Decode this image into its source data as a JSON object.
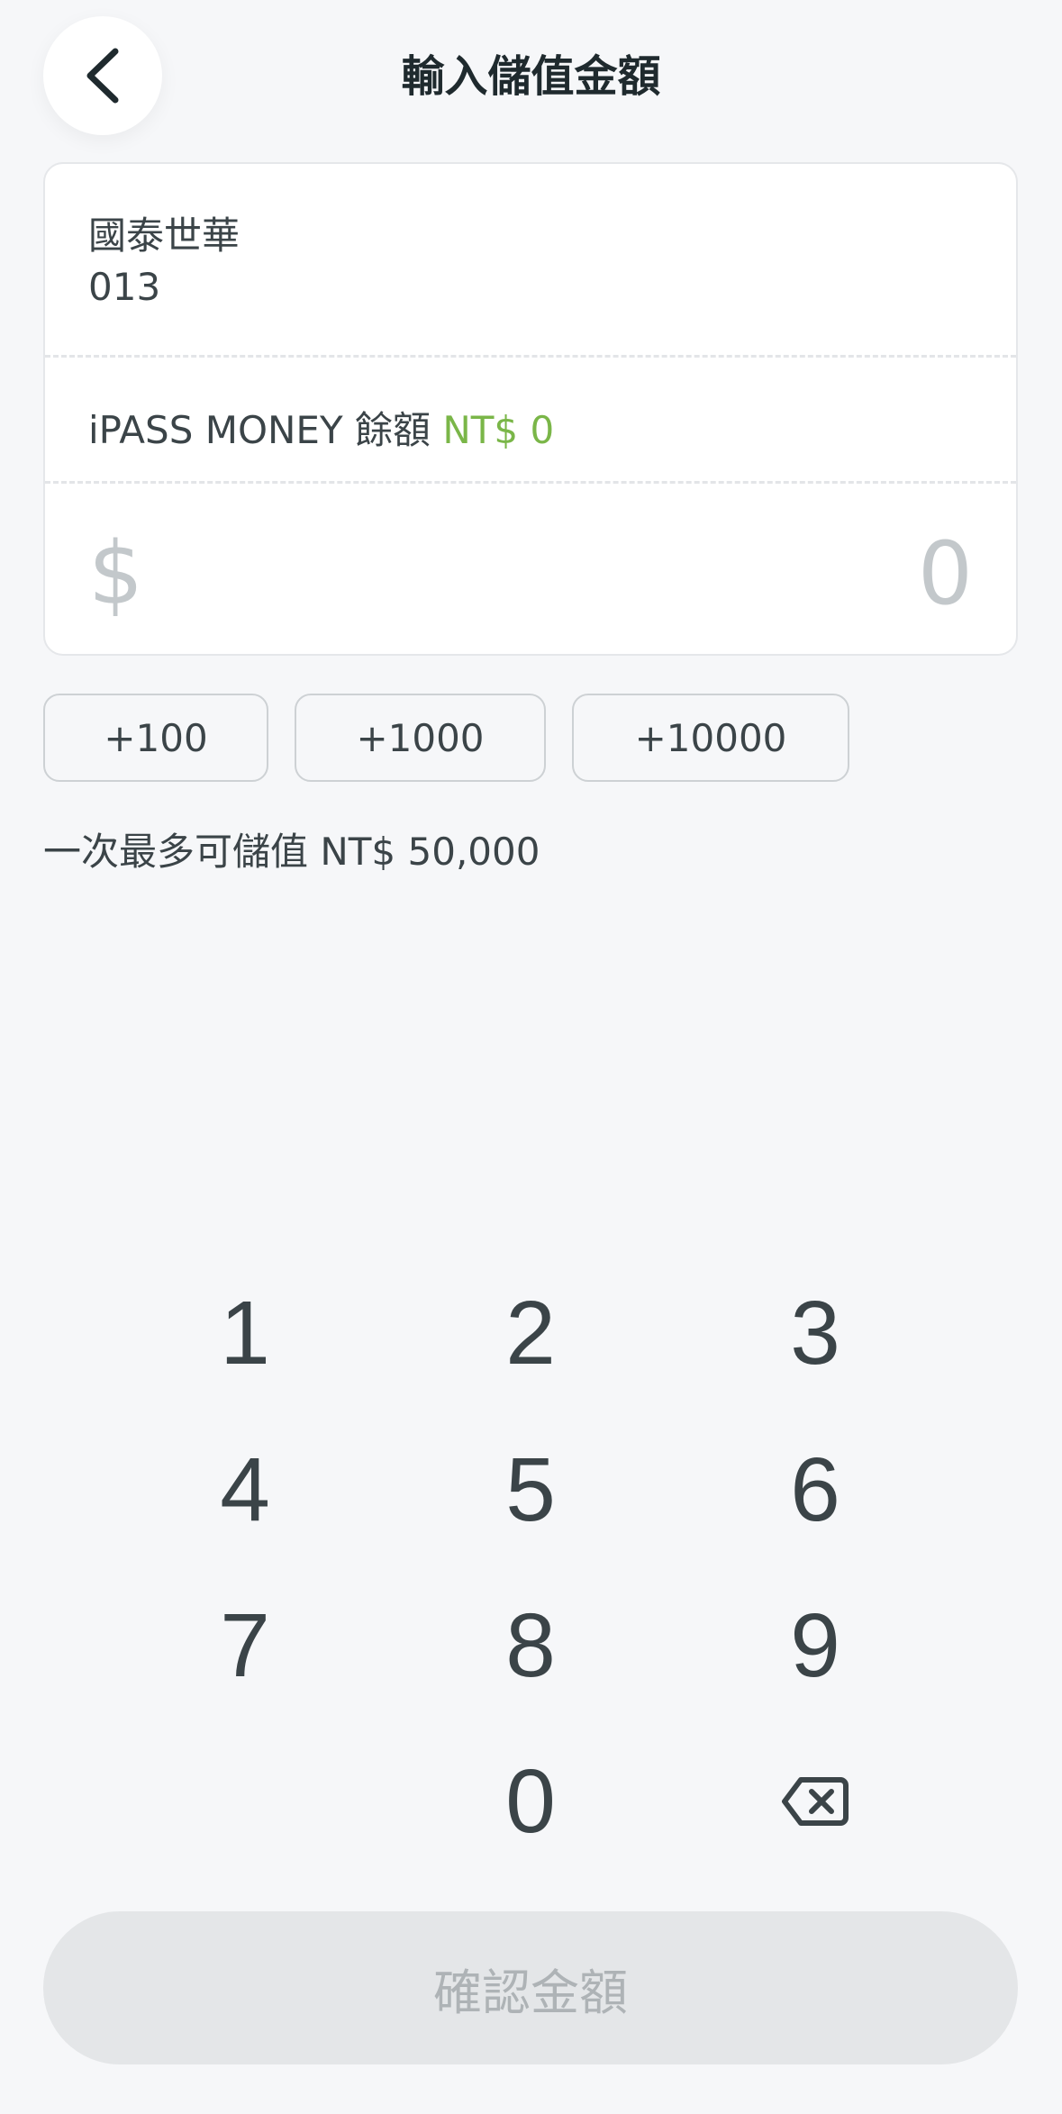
{
  "header": {
    "title": "輸入儲值金額",
    "back_icon": "chevron-left-icon"
  },
  "card": {
    "bank_name": "國泰世華",
    "bank_code": "013",
    "balance_label": "iPASS MONEY 餘額",
    "balance_value": "NT$ 0",
    "amount_symbol": "$",
    "amount_value": "0"
  },
  "quick_add": [
    "+100",
    "+1000",
    "+10000"
  ],
  "limit_note": "一次最多可儲值 NT$ 50,000",
  "keypad": {
    "keys": [
      "1",
      "2",
      "3",
      "4",
      "5",
      "6",
      "7",
      "8",
      "9",
      "0"
    ],
    "backspace_icon": "backspace-icon"
  },
  "confirm_label": "確認金額",
  "colors": {
    "background": "#f6f7f9",
    "accent_green": "#7ab648",
    "placeholder_gray": "#c3c8cb",
    "disabled_button": "#e4e6e8"
  }
}
